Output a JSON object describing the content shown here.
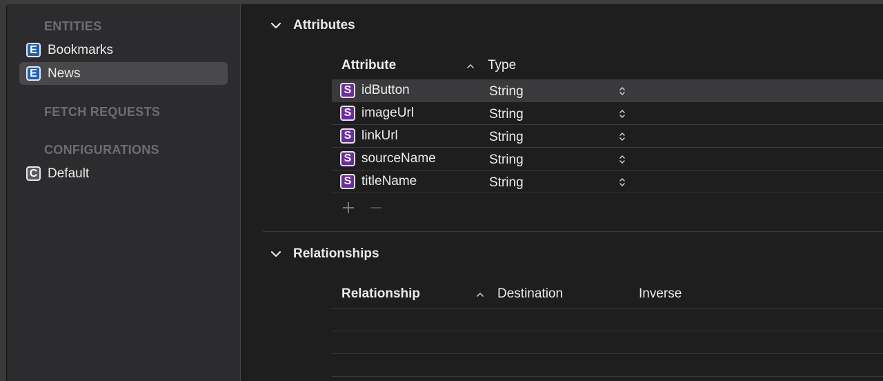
{
  "sidebar": {
    "sections": {
      "entities": "ENTITIES",
      "fetch_requests": "FETCH REQUESTS",
      "configurations": "CONFIGURATIONS"
    },
    "entities": [
      {
        "badge": "E",
        "label": "Bookmarks",
        "selected": false
      },
      {
        "badge": "E",
        "label": "News",
        "selected": true
      }
    ],
    "configurations": [
      {
        "badge": "C",
        "label": "Default"
      }
    ]
  },
  "attributes": {
    "title": "Attributes",
    "columns": {
      "attribute": "Attribute",
      "type": "Type"
    },
    "rows": [
      {
        "badge": "S",
        "name": "idButton",
        "type": "String",
        "selected": true
      },
      {
        "badge": "S",
        "name": "imageUrl",
        "type": "String",
        "selected": false
      },
      {
        "badge": "S",
        "name": "linkUrl",
        "type": "String",
        "selected": false
      },
      {
        "badge": "S",
        "name": "sourceName",
        "type": "String",
        "selected": false
      },
      {
        "badge": "S",
        "name": "titleName",
        "type": "String",
        "selected": false
      }
    ]
  },
  "relationships": {
    "title": "Relationships",
    "columns": {
      "relationship": "Relationship",
      "destination": "Destination",
      "inverse": "Inverse"
    }
  },
  "colors": {
    "entity_badge": "#1f5fb8",
    "attribute_badge": "#6a2ba3",
    "selection": "#48484a",
    "sidebar_bg": "#2c2c2e",
    "main_bg": "#1e1e1e"
  }
}
